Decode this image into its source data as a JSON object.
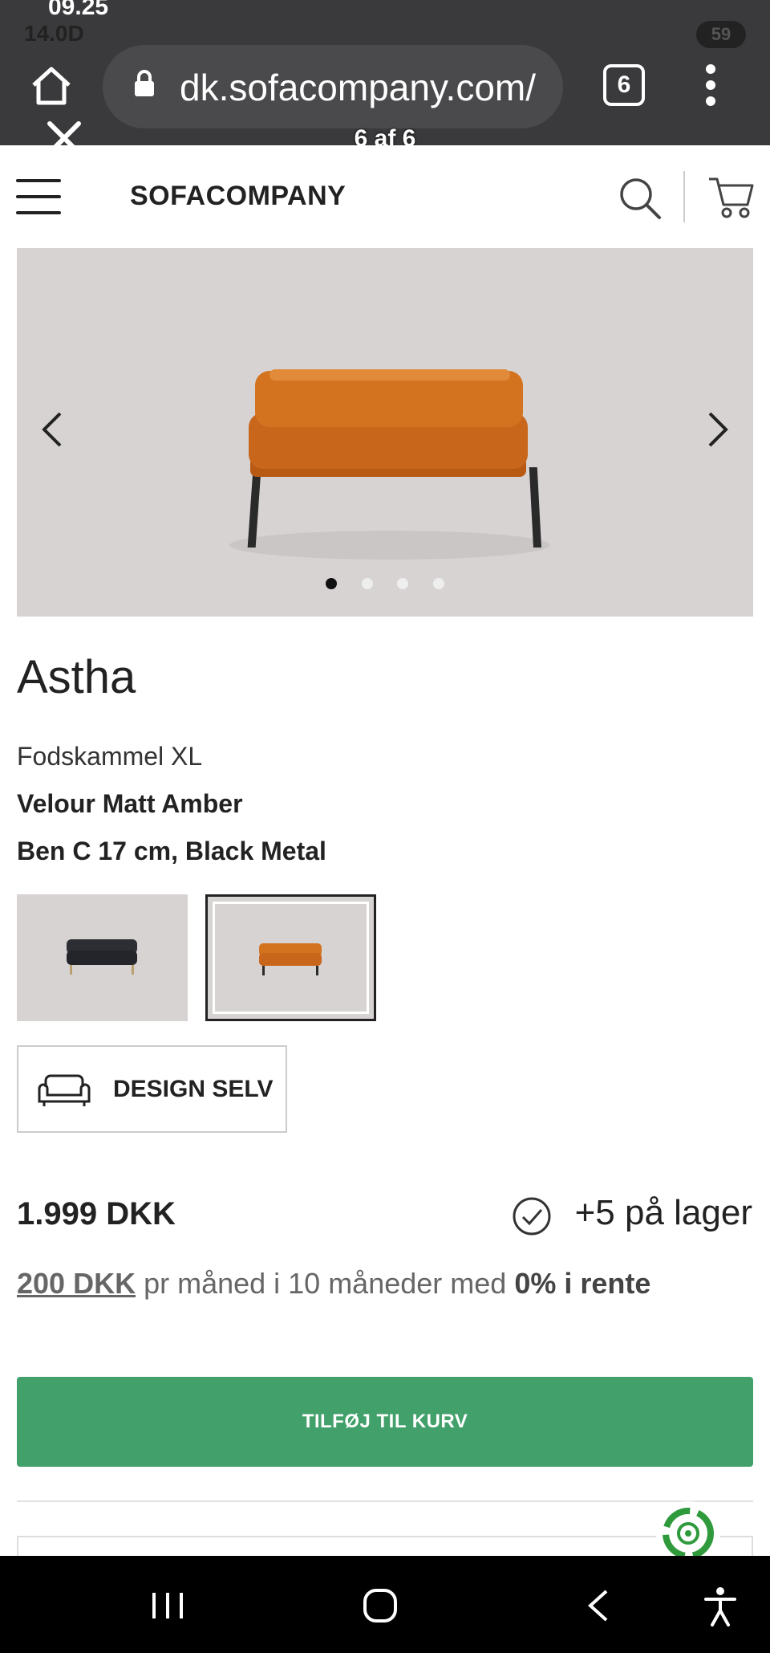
{
  "status_bar": {
    "time_top": "09.25",
    "time_second": "14.0D",
    "battery": "59"
  },
  "browser": {
    "url": "dk.sofacompany.com/",
    "tab_count": "6",
    "viewer_counter": "6 af 6"
  },
  "header": {
    "brand": "SOFACOMPANY"
  },
  "gallery": {
    "slide_count": 4,
    "active_slide": 1
  },
  "product": {
    "title": "Astha",
    "subtitle": "Fodskammel XL",
    "fabric": "Velour Matt Amber",
    "legs": "Ben C 17 cm, Black Metal",
    "price": "1.999 DKK",
    "stock": "+5 på lager",
    "finance_amount": "200 DKK",
    "finance_middle": " pr måned i 10 måneder med ",
    "finance_rate": "0% i rente"
  },
  "actions": {
    "design_label": "DESIGN SELV",
    "add_to_cart_label": "TILFØJ TIL KURV"
  },
  "colors": {
    "accent_green": "#42a06a",
    "amber": "#c8661b",
    "chrome_dark": "#3a3a3c"
  },
  "icons": [
    "home-icon",
    "lock-icon",
    "search-icon",
    "cart-icon",
    "chevron-left-icon",
    "chevron-right-icon",
    "sofa-icon",
    "check-icon",
    "recycle-icon",
    "close-icon"
  ]
}
